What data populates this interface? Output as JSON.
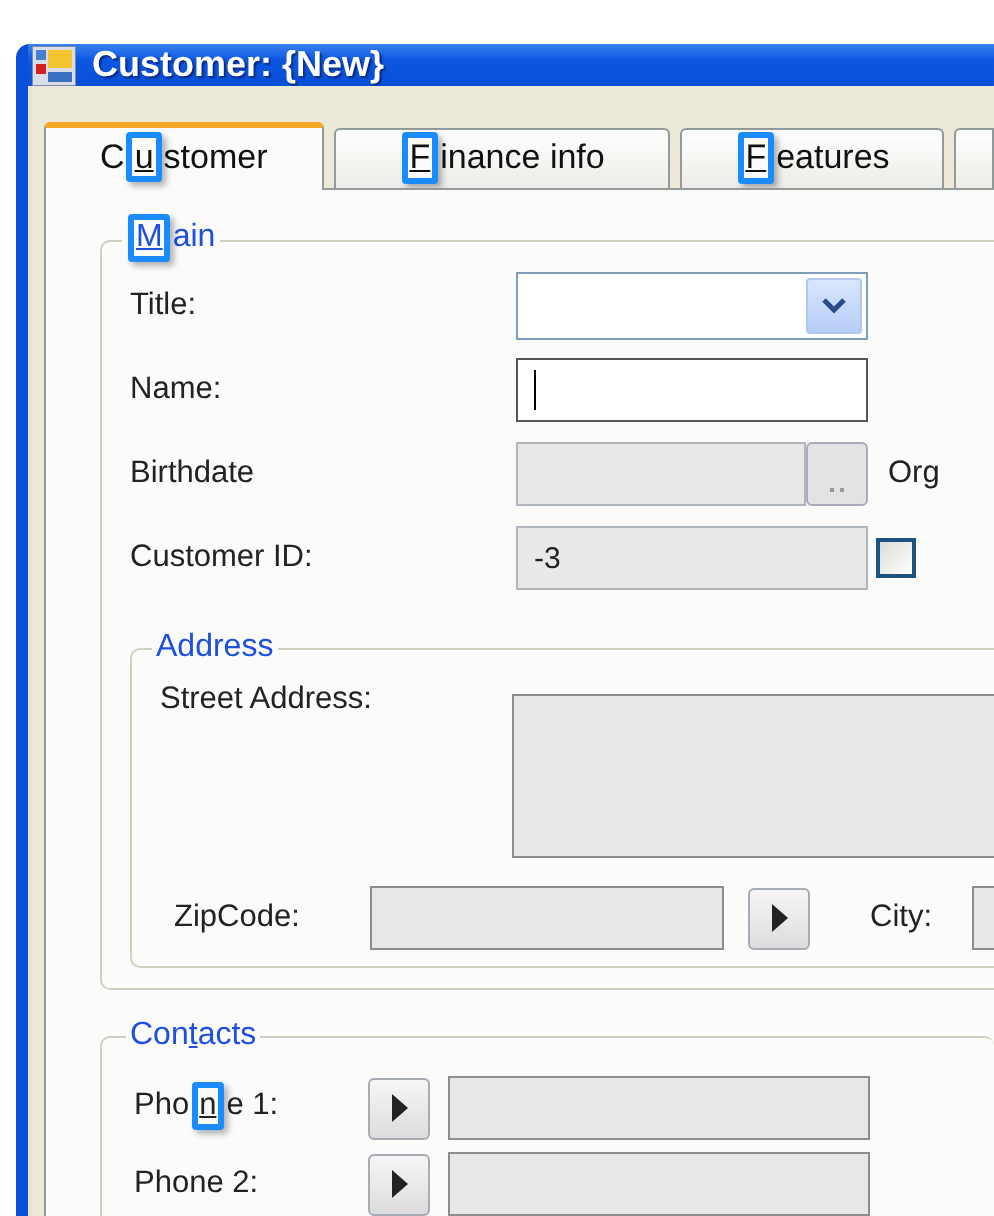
{
  "window": {
    "title": "Customer: {New}"
  },
  "tabs": [
    {
      "label": {
        "pre": "C",
        "key": "u",
        "post": "stomer"
      },
      "selected": true,
      "highlighted": true
    },
    {
      "label": {
        "key": "F",
        "post": "inance info"
      },
      "selected": false,
      "highlighted": true
    },
    {
      "label": {
        "key": "F",
        "post": "eatures"
      },
      "selected": false,
      "highlighted": true
    }
  ],
  "main_group": {
    "title": {
      "key": "M",
      "post": "ain"
    },
    "highlighted": true,
    "fields": [
      {
        "kind": "dropdown",
        "label": "Title:"
      },
      {
        "kind": "text",
        "label": "Name:",
        "focused": true
      },
      {
        "kind": "date",
        "label": "Birthdate",
        "disabled": true,
        "side_label": "Org"
      },
      {
        "kind": "text",
        "label": "Customer ID:",
        "value": "-3",
        "disabled": true,
        "checkbox": {
          "checked": false
        }
      }
    ]
  },
  "address_group": {
    "title": "Address",
    "street": {
      "label": "Street Address:"
    },
    "zip": {
      "label": "ZipCode:"
    },
    "city": {
      "label": "City:"
    }
  },
  "contacts_group": {
    "title": {
      "pre": "Con",
      "key": "t",
      "post": "acts"
    },
    "highlighted": false,
    "phones": [
      {
        "label": {
          "pre": "Pho",
          "key": "n",
          "post": "e 1:"
        },
        "highlighted": true
      },
      {
        "label": "Phone 2:"
      }
    ]
  }
}
